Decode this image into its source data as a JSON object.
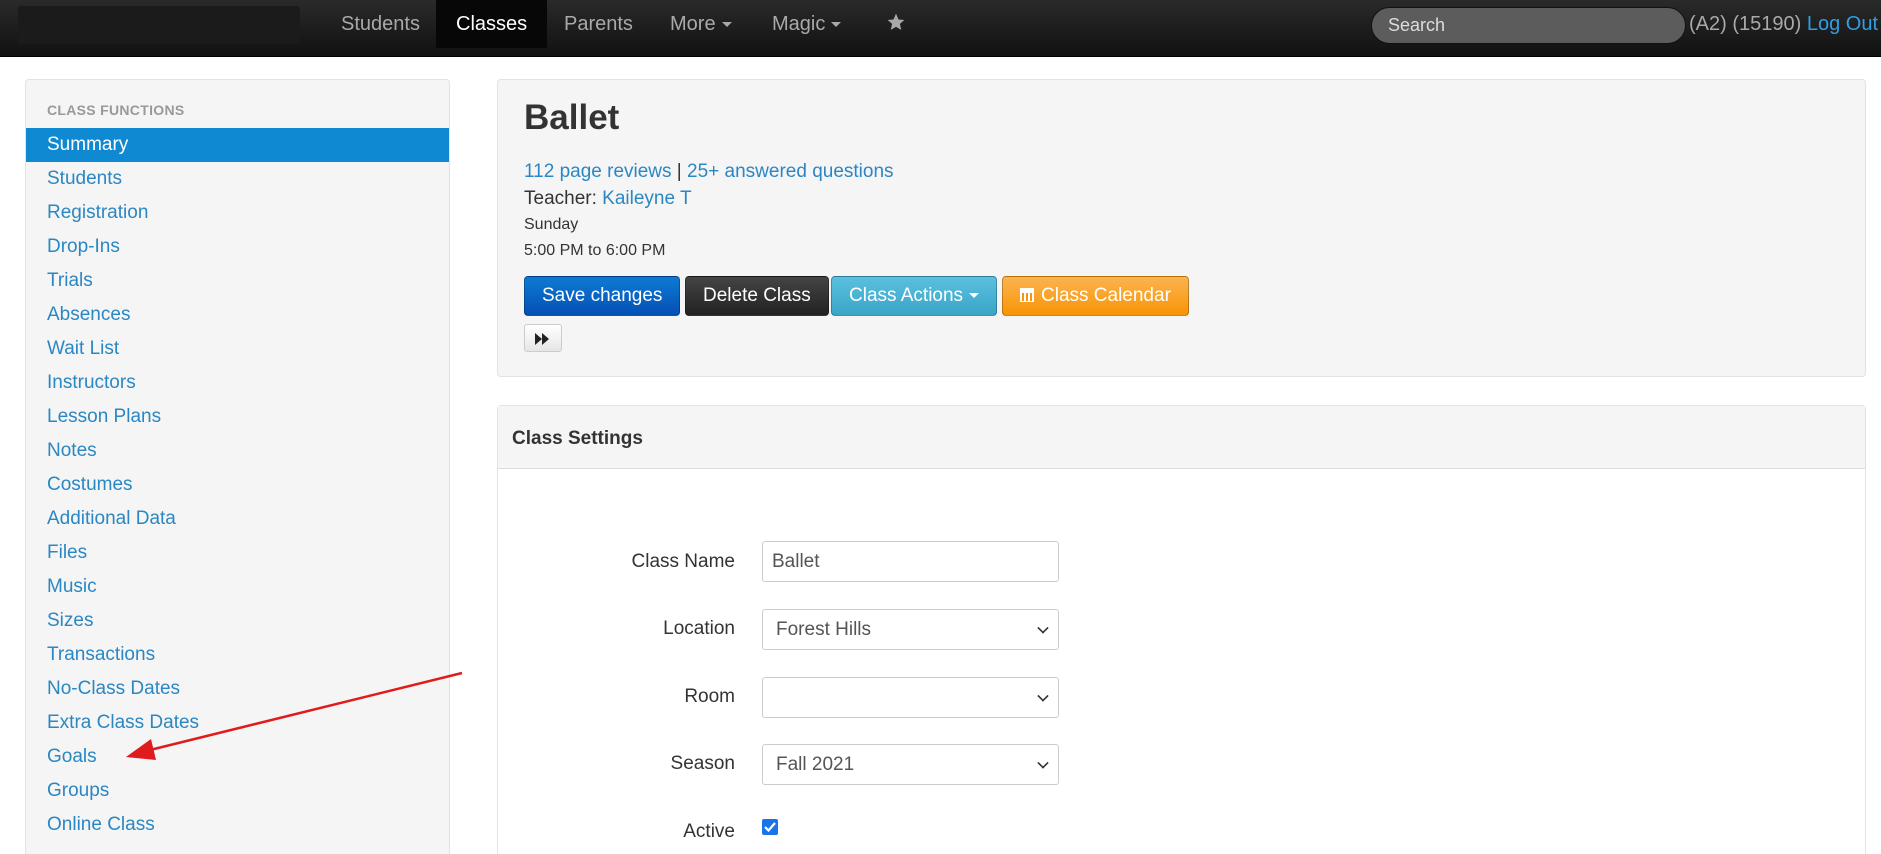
{
  "navbar": {
    "items": [
      {
        "label": "Students"
      },
      {
        "label": "Classes"
      },
      {
        "label": "Parents"
      },
      {
        "label": "More"
      },
      {
        "label": "Magic"
      }
    ],
    "search_placeholder": "Search",
    "user_info": "(A2) (15190)",
    "logout": "Log Out"
  },
  "sidebar": {
    "header": "CLASS FUNCTIONS",
    "items": [
      {
        "label": "Summary"
      },
      {
        "label": "Students"
      },
      {
        "label": "Registration"
      },
      {
        "label": "Drop-Ins"
      },
      {
        "label": "Trials"
      },
      {
        "label": "Absences"
      },
      {
        "label": "Wait List"
      },
      {
        "label": "Instructors"
      },
      {
        "label": "Lesson Plans"
      },
      {
        "label": "Notes"
      },
      {
        "label": "Costumes"
      },
      {
        "label": "Additional Data"
      },
      {
        "label": "Files"
      },
      {
        "label": "Music"
      },
      {
        "label": "Sizes"
      },
      {
        "label": "Transactions"
      },
      {
        "label": "No-Class Dates"
      },
      {
        "label": "Extra Class Dates"
      },
      {
        "label": "Goals"
      },
      {
        "label": "Groups"
      },
      {
        "label": "Online Class"
      }
    ]
  },
  "summary": {
    "title": "Ballet",
    "reviews_link": "112 page reviews",
    "separator": " | ",
    "questions_link": "25+ answered questions",
    "teacher_label": "Teacher: ",
    "teacher_name": "Kaileyne T",
    "day": "Sunday",
    "time": "5:00 PM to 6:00 PM",
    "buttons": {
      "save": "Save changes",
      "delete": "Delete Class",
      "actions": "Class Actions",
      "calendar": "Class Calendar"
    }
  },
  "settings": {
    "title": "Class Settings",
    "fields": {
      "class_name": {
        "label": "Class Name",
        "value": "Ballet"
      },
      "location": {
        "label": "Location",
        "value": "Forest Hills"
      },
      "room": {
        "label": "Room",
        "value": ""
      },
      "season": {
        "label": "Season",
        "value": "Fall 2021"
      },
      "active": {
        "label": "Active",
        "checked": true
      }
    }
  },
  "colors": {
    "accent": "#0f8ad2",
    "link": "#2a87c3",
    "annotation_arrow": "#e01b1b"
  }
}
